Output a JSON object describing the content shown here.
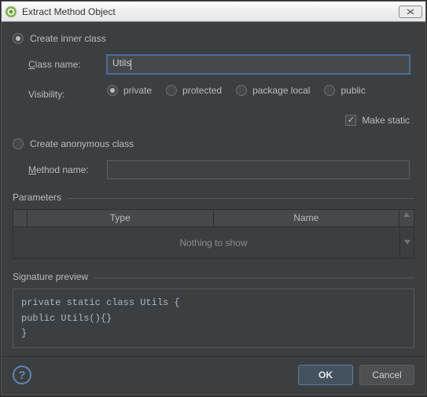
{
  "window": {
    "title": "Extract Method Object"
  },
  "radios": {
    "create_inner": "Create inner class",
    "create_anon": "Create anonymous class"
  },
  "form": {
    "class_name_label_pre": "C",
    "class_name_label_post": "lass name:",
    "class_name_value": "Utils",
    "visibility_label": "Visibility:",
    "vis_private": "private",
    "vis_protected": "protected",
    "vis_package": "package local",
    "vis_public": "public",
    "make_static": "Make static",
    "method_name_label_pre": "M",
    "method_name_label_post": "ethod name:",
    "method_name_value": ""
  },
  "params": {
    "header": "Parameters",
    "col_type": "Type",
    "col_name": "Name",
    "empty": "Nothing to show"
  },
  "preview": {
    "header": "Signature preview",
    "line1": "private static class Utils {",
    "line2": "    public Utils(){}",
    "line3": "}"
  },
  "footer": {
    "help": "?",
    "ok": "OK",
    "cancel": "Cancel"
  }
}
